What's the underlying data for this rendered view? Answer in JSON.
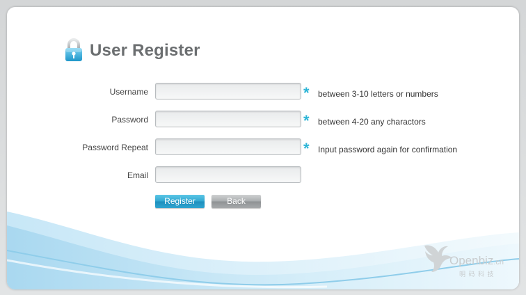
{
  "page": {
    "title": "User Register"
  },
  "form": {
    "fields": [
      {
        "label": "Username",
        "value": "",
        "required_mark": "*",
        "hint": "between 3-10 letters or numbers"
      },
      {
        "label": "Password",
        "value": "",
        "required_mark": "*",
        "hint": "between 4-20 any charactors"
      },
      {
        "label": "Password Repeat",
        "value": "",
        "required_mark": "*",
        "hint": "Input password again for confirmation"
      },
      {
        "label": "Email",
        "value": ""
      }
    ],
    "register_label": "Register",
    "back_label": "Back"
  },
  "brand": {
    "name": "Openbiz",
    "suffix": ".cn",
    "sub": "明 码 科 技"
  },
  "colors": {
    "accent": "#2ab4d6",
    "title": "#6b6e70",
    "wave": "#bfe3f4"
  },
  "icons": {
    "lock": "lock-icon",
    "logo": "openbiz-bird-logo"
  }
}
